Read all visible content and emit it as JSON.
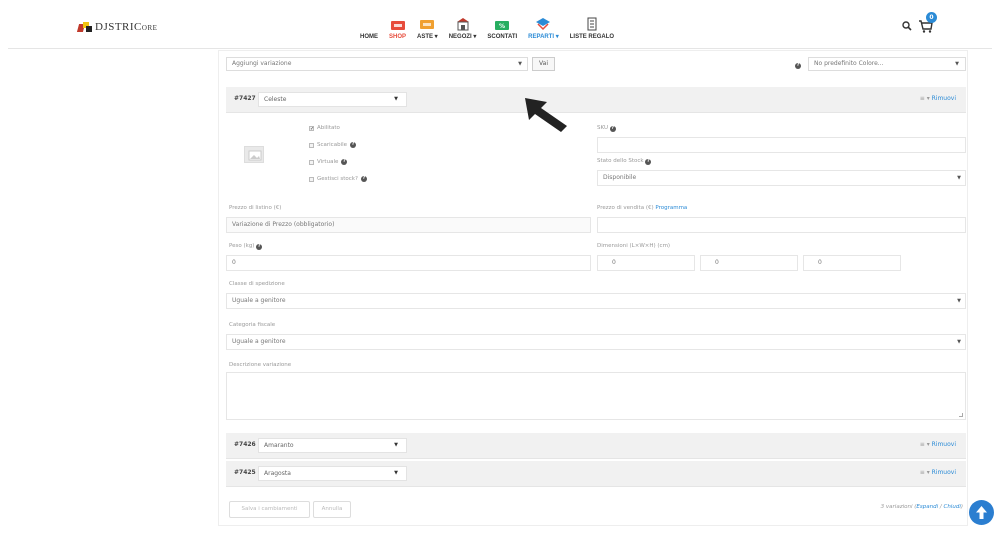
{
  "header": {
    "logo_text": "DJSTRIC",
    "logo_suffix": "ORE",
    "nav": [
      {
        "label": "HOME",
        "icon": "none",
        "style": "plain"
      },
      {
        "label": "SHOP",
        "icon": "shop-badge-icon",
        "style": "red"
      },
      {
        "label": "ASTE ▾",
        "icon": "auction-icon",
        "style": "plain"
      },
      {
        "label": "NEGOZI ▾",
        "icon": "store-icon",
        "style": "plain"
      },
      {
        "label": "SCONTATI",
        "icon": "discount-icon",
        "style": "plain"
      },
      {
        "label": "REPARTI ▾",
        "icon": "departments-icon",
        "style": "blue"
      },
      {
        "label": "LISTE REGALO",
        "icon": "gift-list-icon",
        "style": "plain"
      }
    ],
    "cart_count": "0"
  },
  "toolbar": {
    "add_variation": "Aggiungi variazione",
    "vai": "Vai",
    "default_color": "No predefinito Colore..."
  },
  "variations": [
    {
      "id": "#7427",
      "name": "Celeste",
      "remove": "Rimuovi"
    },
    {
      "id": "#7426",
      "name": "Amaranto",
      "remove": "Rimuovi"
    },
    {
      "id": "#7425",
      "name": "Aragosta",
      "remove": "Rimuovi"
    }
  ],
  "form": {
    "enabled": "Abilitato",
    "downloadable": "Scaricabile",
    "virtual": "Virtuale",
    "manage_stock": "Gestisci stock?",
    "sku_label": "SKU",
    "stock_status_label": "Stato dello Stock",
    "stock_status_value": "Disponibile",
    "regular_price_label": "Prezzo di listino (€)",
    "regular_price_placeholder": "Variazione di Prezzo (obbligatorio)",
    "sale_price_label": "Prezzo di vendita (€)",
    "sale_price_link": "Programma",
    "weight_label": "Peso (kg)",
    "weight_value": "0",
    "dimensions_label": "Dimensioni (L×W×H) (cm)",
    "dim_l": "0",
    "dim_w": "0",
    "dim_h": "0",
    "shipping_class_label": "Classe di spedizione",
    "shipping_class_value": "Uguale a genitore",
    "tax_class_label": "Categoria fiscale",
    "tax_class_value": "Uguale a genitore",
    "description_label": "Descrizione variazione"
  },
  "footer": {
    "save": "Salva i cambiamenti",
    "cancel": "Annulla",
    "count_text": "3 variazioni (",
    "expand": "Espandi",
    "sep": " / ",
    "close": "Chiudi",
    "close_paren": ")"
  },
  "colors": {
    "accent": "#2b8bd6",
    "header_bg": "#f1f1f1"
  }
}
